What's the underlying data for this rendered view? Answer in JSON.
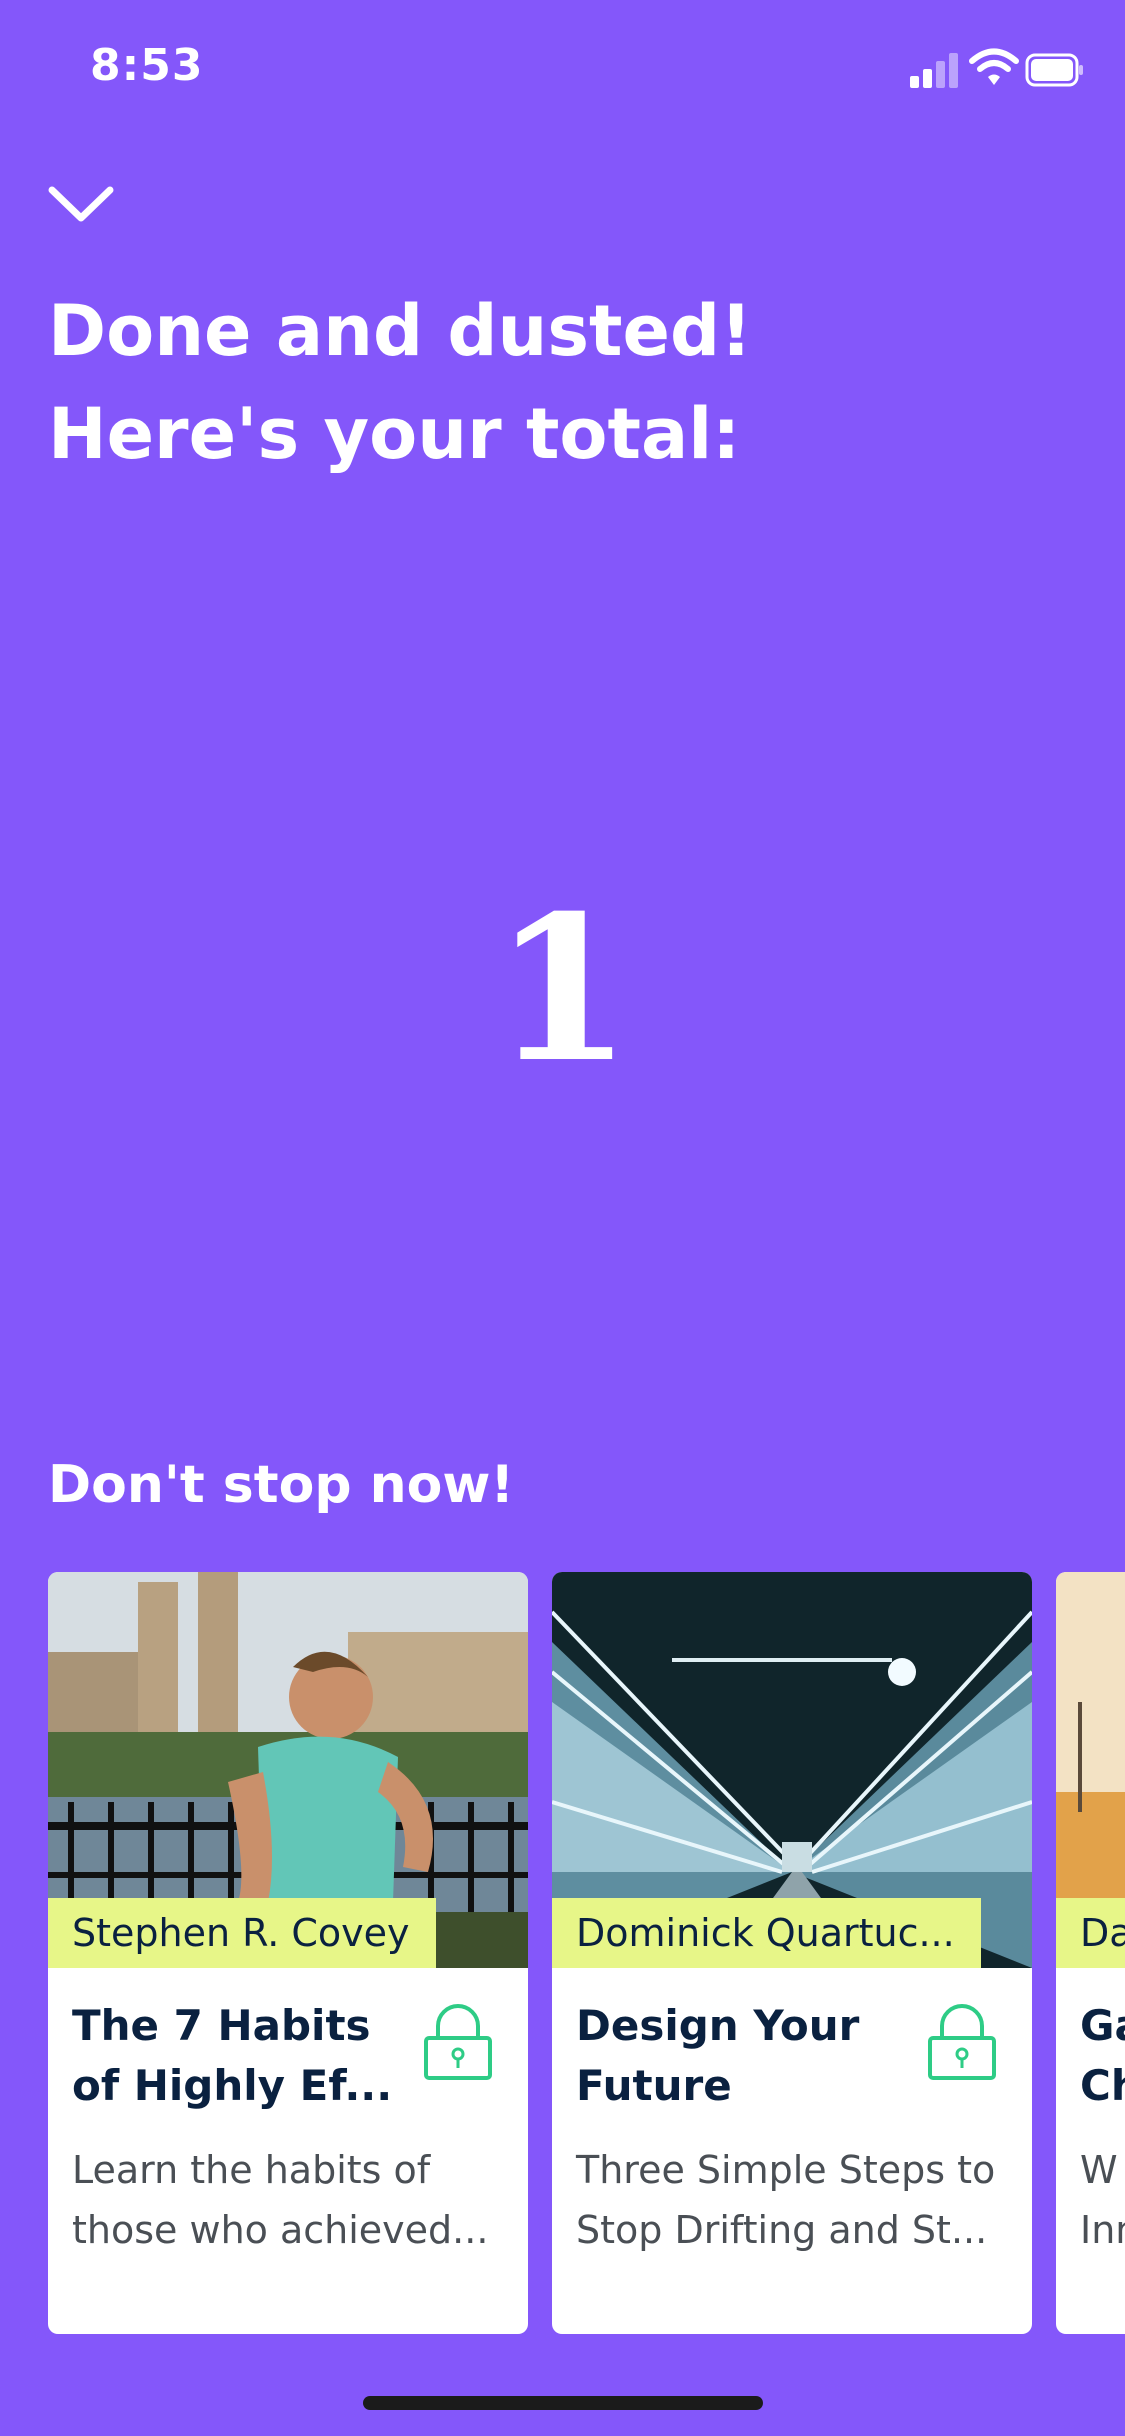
{
  "status_bar": {
    "time": "8:53"
  },
  "header": {
    "title_line1": "Done and dusted!",
    "title_line2": "Here's your total:"
  },
  "total_value": "1",
  "recommendations": {
    "title": "Don't stop now!",
    "cards": [
      {
        "author": "Stephen R. Covey",
        "title": "The 7 Habits\nof Highly Ef...",
        "description": "Learn the habits of\nthose who achieved...",
        "locked": true,
        "image_icon": "runner-photo"
      },
      {
        "author": "Dominick Quartuc...",
        "title": "Design Your\nFuture",
        "description": "Three Simple Steps to\nStop Drifting and St...",
        "locked": true,
        "image_icon": "walkway-photo"
      },
      {
        "author": "Da",
        "title": "Ga\nCh",
        "description": "W\nInn",
        "locked": true,
        "image_icon": "field-photo"
      }
    ]
  },
  "colors": {
    "background": "#8457FA",
    "author_chip": "#E7F688",
    "title_text": "#0A2140",
    "lock": "#2ECC86"
  }
}
